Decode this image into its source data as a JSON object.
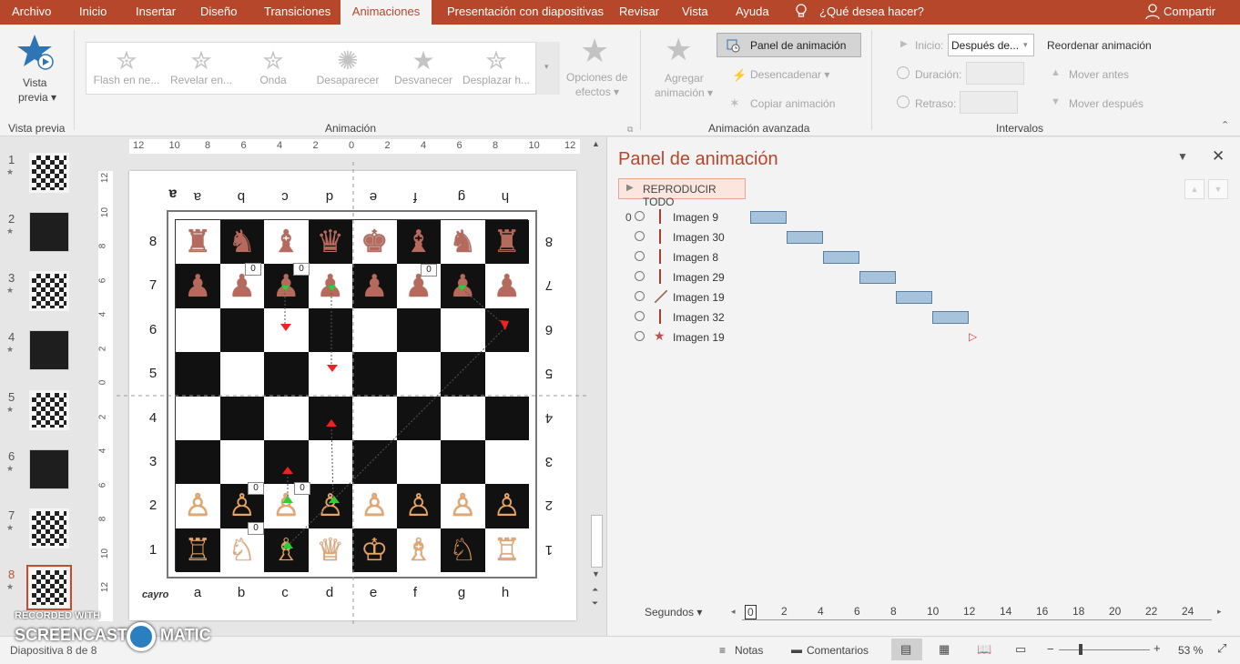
{
  "tabs": [
    {
      "label": "Archivo"
    },
    {
      "label": "Inicio"
    },
    {
      "label": "Insertar"
    },
    {
      "label": "Diseño"
    },
    {
      "label": "Transiciones"
    },
    {
      "label": "Animaciones",
      "active": true
    },
    {
      "label": "Presentación con diapositivas"
    },
    {
      "label": "Revisar"
    },
    {
      "label": "Vista"
    },
    {
      "label": "Ayuda"
    }
  ],
  "tellme": "¿Qué desea hacer?",
  "share": "Compartir",
  "ribbon": {
    "preview": {
      "label1": "Vista",
      "label2": "previa ▾",
      "group": "Vista previa"
    },
    "gallery": [
      {
        "label": "Flash en ne..."
      },
      {
        "label": "Revelar en..."
      },
      {
        "label": "Onda"
      },
      {
        "label": "Desaparecer"
      },
      {
        "label": "Desvanecer"
      },
      {
        "label": "Desplazar h..."
      }
    ],
    "effect_options": {
      "label1": "Opciones de",
      "label2": "efectos ▾"
    },
    "animation_group": "Animación",
    "add_anim": {
      "label1": "Agregar",
      "label2": "animación ▾"
    },
    "anim_pane_btn": "Panel de animación",
    "trigger": "Desencadenar ▾",
    "copy_anim": "Copiar animación",
    "advanced_group": "Animación avanzada",
    "start_label": "Inicio:",
    "start_value": "Después de...",
    "duration_label": "Duración:",
    "delay_label": "Retraso:",
    "reorder": "Reordenar animación",
    "move_earlier": "Mover antes",
    "move_later": "Mover después",
    "timing_group": "Intervalos"
  },
  "slides": [
    {
      "num": "1",
      "kind": "chess"
    },
    {
      "num": "2",
      "kind": "dark"
    },
    {
      "num": "3",
      "kind": "chess"
    },
    {
      "num": "4",
      "kind": "dark"
    },
    {
      "num": "5",
      "kind": "chess"
    },
    {
      "num": "6",
      "kind": "dark"
    },
    {
      "num": "7",
      "kind": "chess"
    },
    {
      "num": "8",
      "kind": "chess",
      "selected": true
    }
  ],
  "ruler_top": [
    "12",
    "10",
    "8",
    "6",
    "4",
    "2",
    "0",
    "2",
    "4",
    "6",
    "8",
    "10",
    "12"
  ],
  "ruler_left": [
    "12",
    "10",
    "8",
    "6",
    "4",
    "2",
    "0",
    "2",
    "4",
    "6",
    "8",
    "10",
    "12"
  ],
  "board": {
    "files_bottom": [
      "a",
      "b",
      "c",
      "d",
      "e",
      "f",
      "g",
      "h"
    ],
    "files_top": [
      "a",
      "b",
      "c",
      "d",
      "e",
      "f",
      "g",
      "h"
    ],
    "ranks": [
      "8",
      "7",
      "6",
      "5",
      "4",
      "3",
      "2",
      "1"
    ],
    "rows": [
      [
        "♜",
        "♞",
        "♝",
        "♛",
        "♚",
        "♝",
        "♞",
        "♜"
      ],
      [
        "♟",
        "♟",
        "♟",
        "♟",
        "♟",
        "♟",
        "♟",
        "♟"
      ],
      [
        "",
        "",
        "",
        "",
        "",
        "",
        "",
        ""
      ],
      [
        "",
        "",
        "",
        "",
        "",
        "",
        "",
        ""
      ],
      [
        "",
        "",
        "",
        "",
        "",
        "",
        "",
        ""
      ],
      [
        "",
        "",
        "",
        "",
        "",
        "",
        "",
        ""
      ],
      [
        "♙",
        "♙",
        "♙",
        "♙",
        "♙",
        "♙",
        "♙",
        "♙"
      ],
      [
        "♖",
        "♘",
        "♗",
        "♕",
        "♔",
        "♗",
        "♘",
        "♖"
      ]
    ],
    "tags": [
      "0",
      "0",
      "0",
      "0",
      "0",
      "0"
    ],
    "logo": "cayro"
  },
  "panel": {
    "title": "Panel de animación",
    "play_all": "REPRODUCIR TODO",
    "items": [
      {
        "num": "0",
        "name": "Imagen 9",
        "icon": "line-vertical",
        "start": 0
      },
      {
        "num": "",
        "name": "Imagen 30",
        "icon": "line-vertical",
        "start": 1
      },
      {
        "num": "",
        "name": "Imagen 8",
        "icon": "line-vertical",
        "start": 2
      },
      {
        "num": "",
        "name": "Imagen 29",
        "icon": "line-vertical",
        "start": 3
      },
      {
        "num": "",
        "name": "Imagen 19",
        "icon": "line-diagonal",
        "start": 4
      },
      {
        "num": "",
        "name": "Imagen 32",
        "icon": "line-vertical",
        "start": 5
      },
      {
        "num": "",
        "name": "Imagen 19",
        "icon": "star",
        "start": 6
      }
    ],
    "seconds_label": "Segundos ▾",
    "timeline": [
      "0",
      "2",
      "4",
      "6",
      "8",
      "10",
      "12",
      "14",
      "16",
      "18",
      "20",
      "22",
      "24"
    ]
  },
  "status": {
    "slide": "Diapositiva 8 de 8",
    "notes": "Notas",
    "comments": "Comentarios",
    "zoom": "53 %"
  },
  "watermark": {
    "line1": "RECORDED WITH",
    "line2": "SCREENCAST",
    "line3": "MATIC"
  },
  "colors": {
    "accent": "#b7472a",
    "bar": "#a6c3db",
    "dark_piece": "#b56a5d",
    "light_piece": "#e6a66a"
  }
}
